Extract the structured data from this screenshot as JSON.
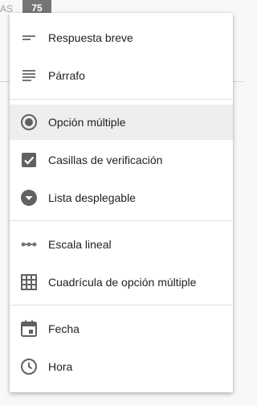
{
  "background": {
    "fragment_text": "AS",
    "badge_value": "75"
  },
  "menu": {
    "items": [
      {
        "label": "Respuesta breve",
        "icon": "short-text-icon"
      },
      {
        "label": "Párrafo",
        "icon": "paragraph-icon"
      },
      {
        "label": "Opción múltiple",
        "icon": "radio-button-icon",
        "selected": true
      },
      {
        "label": "Casillas de verificación",
        "icon": "checkbox-icon"
      },
      {
        "label": "Lista desplegable",
        "icon": "dropdown-icon"
      },
      {
        "label": "Escala lineal",
        "icon": "linear-scale-icon"
      },
      {
        "label": "Cuadrícula de opción múltiple",
        "icon": "grid-icon"
      },
      {
        "label": "Fecha",
        "icon": "calendar-icon"
      },
      {
        "label": "Hora",
        "icon": "clock-icon"
      }
    ]
  },
  "colors": {
    "icon": "#757575",
    "selected_bg": "#eeeeee",
    "badge_bg": "#757575"
  }
}
